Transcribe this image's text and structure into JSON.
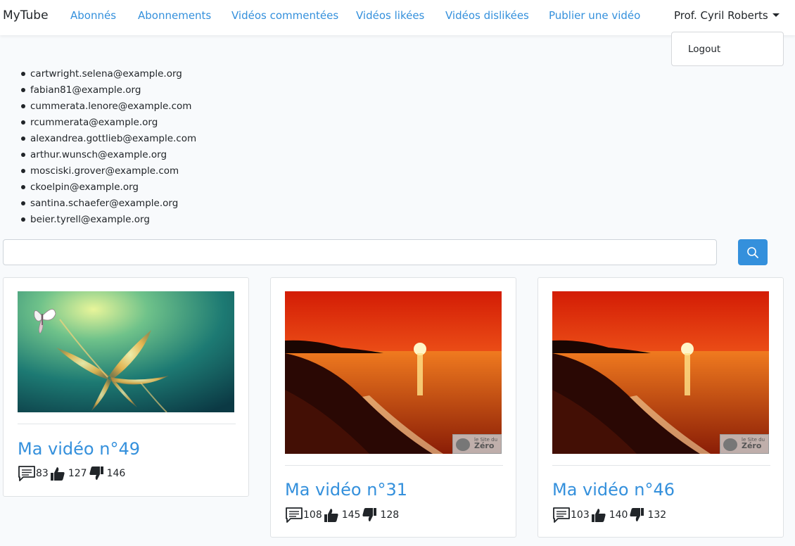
{
  "nav": {
    "brand": "MyTube",
    "links": [
      "Abonnés",
      "Abonnements",
      "Vidéos commentées",
      "Vidéos likées",
      "Vidéos dislikées",
      "Publier une vidéo"
    ],
    "user": "Prof. Cyril Roberts",
    "dropdown": {
      "logout": "Logout"
    }
  },
  "emails": [
    "cartwright.selena@example.org",
    "fabian81@example.org",
    "cummerata.lenore@example.com",
    "rcummerata@example.org",
    "alexandrea.gottlieb@example.com",
    "arthur.wunsch@example.org",
    "mosciski.grover@example.com",
    "ckoelpin@example.org",
    "santina.schaefer@example.org",
    "beier.tyrell@example.org"
  ],
  "search": {
    "value": "",
    "icon": "search-icon"
  },
  "videos": [
    {
      "title": "Ma vidéo n°49",
      "comments": "83",
      "likes": "127",
      "dislikes": "146",
      "thumbnail": "flower-butterfly"
    },
    {
      "title": "Ma vidéo n°31",
      "comments": "108",
      "likes": "145",
      "dislikes": "128",
      "thumbnail": "sunset-beach"
    },
    {
      "title": "Ma vidéo n°46",
      "comments": "103",
      "likes": "140",
      "dislikes": "132",
      "thumbnail": "sunset-beach"
    }
  ],
  "watermark": {
    "line1": "le Site du",
    "line2": "Zéro"
  },
  "colors": {
    "accent": "#3490dc",
    "background": "#f8fafc"
  }
}
